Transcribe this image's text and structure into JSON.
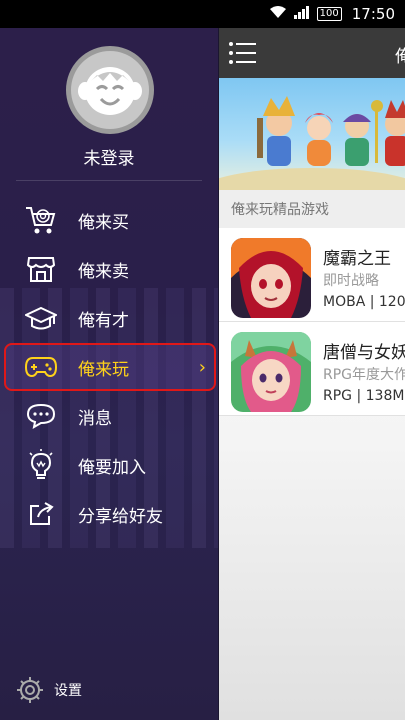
{
  "status_bar": {
    "battery": "100",
    "time": "17:50"
  },
  "drawer": {
    "username": "未登录",
    "menu": [
      {
        "label": "俺来买",
        "icon": "shopping-cart-icon"
      },
      {
        "label": "俺来卖",
        "icon": "shop-icon"
      },
      {
        "label": "俺有才",
        "icon": "graduation-cap-icon"
      },
      {
        "label": "俺来玩",
        "icon": "gamepad-icon",
        "active": true
      },
      {
        "label": "消息",
        "icon": "chat-bubble-icon"
      },
      {
        "label": "俺要加入",
        "icon": "lightbulb-icon"
      },
      {
        "label": "分享给好友",
        "icon": "share-icon"
      }
    ],
    "settings_label": "设置"
  },
  "main": {
    "title": "俺",
    "section_title": "俺来玩精品游戏",
    "games": [
      {
        "name": "魔霸之王",
        "genre": "即时战略",
        "meta": "MOBA | 120"
      },
      {
        "name": "唐僧与女妖",
        "genre": "RPG年度大作",
        "meta": "RPG | 138M"
      }
    ]
  },
  "colors": {
    "accent": "#ffd21a",
    "highlight_border": "#e01818",
    "drawer_bg": "#2c1f4a"
  }
}
